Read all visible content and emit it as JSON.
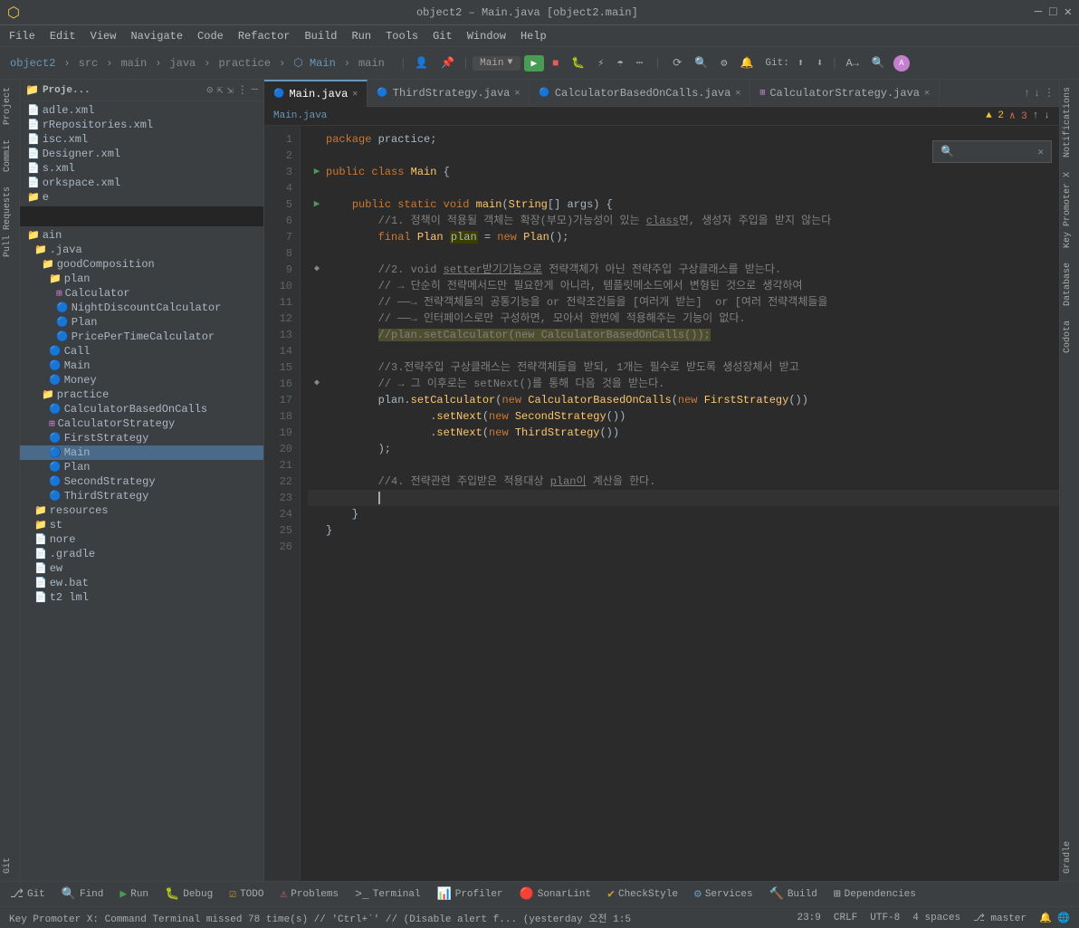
{
  "titleBar": {
    "icon": "⬡",
    "title": "object2 – Main.java [object2.main]",
    "btnMin": "─",
    "btnMax": "□",
    "btnClose": "✕"
  },
  "menuBar": {
    "items": [
      "File",
      "Edit",
      "View",
      "Navigate",
      "Code",
      "Refactor",
      "Build",
      "Run",
      "Tools",
      "Git",
      "Window",
      "Help"
    ]
  },
  "toolbar": {
    "project": "object2",
    "separator": "›",
    "path": [
      "src",
      "main",
      "java",
      "practice",
      "Main",
      "main"
    ],
    "runConfig": "Main",
    "git": "Git:",
    "gitBranch": "master"
  },
  "sidebar": {
    "title": "Proje...",
    "files": [
      {
        "name": "adle.xml",
        "icon": "📄",
        "indent": 0,
        "type": "xml"
      },
      {
        "name": "rRepositories.xml",
        "icon": "📄",
        "indent": 0,
        "type": "xml"
      },
      {
        "name": "isc.xml",
        "icon": "📄",
        "indent": 0,
        "type": "xml"
      },
      {
        "name": "Designer.xml",
        "icon": "📄",
        "indent": 0,
        "type": "xml"
      },
      {
        "name": "s.xml",
        "icon": "📄",
        "indent": 0,
        "type": "xml"
      },
      {
        "name": "orkspace.xml",
        "icon": "📄",
        "indent": 0,
        "type": "xml"
      },
      {
        "name": "e",
        "icon": "📁",
        "indent": 0,
        "type": "folder"
      },
      {
        "name": "ain",
        "icon": "📁",
        "indent": 0,
        "type": "folder"
      },
      {
        "name": ".java",
        "icon": "📁",
        "indent": 1,
        "type": "folder"
      },
      {
        "name": "goodComposition",
        "icon": "📁",
        "indent": 2,
        "type": "folder"
      },
      {
        "name": "plan",
        "icon": "📁",
        "indent": 3,
        "type": "folder"
      },
      {
        "name": "Calculator",
        "icon": "⊞",
        "indent": 4,
        "type": "class"
      },
      {
        "name": "NightDiscountCalculator",
        "icon": "🔵",
        "indent": 4,
        "type": "java"
      },
      {
        "name": "Plan",
        "icon": "🔵",
        "indent": 4,
        "type": "java"
      },
      {
        "name": "PricePerTimeCalculator",
        "icon": "🔵",
        "indent": 4,
        "type": "java"
      },
      {
        "name": "Call",
        "icon": "🔵",
        "indent": 3,
        "type": "java"
      },
      {
        "name": "Main",
        "icon": "🔵",
        "indent": 3,
        "type": "java"
      },
      {
        "name": "Money",
        "icon": "🔵",
        "indent": 3,
        "type": "java"
      },
      {
        "name": "practice",
        "icon": "📁",
        "indent": 2,
        "type": "folder"
      },
      {
        "name": "CalculatorBasedOnCalls",
        "icon": "🔵",
        "indent": 3,
        "type": "java"
      },
      {
        "name": "CalculatorStrategy",
        "icon": "⊞",
        "indent": 3,
        "type": "class"
      },
      {
        "name": "FirstStrategy",
        "icon": "🔵",
        "indent": 3,
        "type": "java"
      },
      {
        "name": "Main",
        "icon": "🔵",
        "indent": 3,
        "type": "java",
        "selected": true
      },
      {
        "name": "Plan",
        "icon": "🔵",
        "indent": 3,
        "type": "java"
      },
      {
        "name": "SecondStrategy",
        "icon": "🔵",
        "indent": 3,
        "type": "java"
      },
      {
        "name": "ThirdStrategy",
        "icon": "🔵",
        "indent": 3,
        "type": "java"
      },
      {
        "name": "resources",
        "icon": "📁",
        "indent": 1,
        "type": "folder"
      },
      {
        "name": "st",
        "icon": "📁",
        "indent": 1,
        "type": "folder"
      },
      {
        "name": "nore",
        "icon": "📄",
        "indent": 1,
        "type": "file"
      },
      {
        "name": ".gradle",
        "icon": "📄",
        "indent": 1,
        "type": "file"
      },
      {
        "name": "ew",
        "icon": "📄",
        "indent": 1,
        "type": "file"
      },
      {
        "name": "ew.bat",
        "icon": "📄",
        "indent": 1,
        "type": "file"
      },
      {
        "name": "t2 lml",
        "icon": "📄",
        "indent": 1,
        "type": "file"
      }
    ]
  },
  "tabs": [
    {
      "name": "Main.java",
      "active": true,
      "icon": "🔵"
    },
    {
      "name": "ThirdStrategy.java",
      "active": false,
      "icon": "🔵"
    },
    {
      "name": "CalculatorBasedOnCalls.java",
      "active": false,
      "icon": "🔵"
    },
    {
      "name": "CalculatorStrategy.java",
      "active": false,
      "icon": "⊞"
    }
  ],
  "editorBreadcrumb": {
    "path": "Main.java",
    "warning": "▲ 2",
    "error": "∧ 3",
    "up": "↑",
    "down": "↓"
  },
  "rightPanels": [
    "Notifications",
    "Key Promoter X",
    "Database",
    "Codota",
    "Gradle"
  ],
  "leftPanels": [
    "Project",
    "Commit",
    "Pull Requests",
    "Git"
  ],
  "code": {
    "lines": [
      {
        "num": 1,
        "gutter": "",
        "content": "<span class='kw'>package</span> practice;"
      },
      {
        "num": 2,
        "gutter": "",
        "content": ""
      },
      {
        "num": 3,
        "gutter": "▶",
        "content": "<span class='kw'>public class</span> <span class='cls'>Main</span> {"
      },
      {
        "num": 4,
        "gutter": "",
        "content": ""
      },
      {
        "num": 5,
        "gutter": "▶",
        "content": "    <span class='kw'>public static void</span> <span class='method'>main</span>(<span class='cls'>String</span>[] args) {"
      },
      {
        "num": 6,
        "gutter": "",
        "content": "        <span class='comment'>//1. 정책이 적용될 객체는 확장(부모)가능성이 있는 <span class='underline'>class</span>면, 생성자 주입을 받지 않는다</span>"
      },
      {
        "num": 7,
        "gutter": "",
        "content": "        <span class='kw'>final</span> <span class='cls'>Plan</span> <span class='highlight'>plan</span> = <span class='kw'>new</span> <span class='cls'>Plan</span>();"
      },
      {
        "num": 8,
        "gutter": "",
        "content": ""
      },
      {
        "num": 9,
        "gutter": "",
        "content": "        <span class='comment'>//2. void <span class='underline'>setter받기기능으로</span> 전략객체가 아닌 전략주입 구상클래스를 받는다.</span>"
      },
      {
        "num": 10,
        "gutter": "",
        "content": "        <span class='comment'>// → 단순히 전략메서드만 필요한게 아니라, 템플릿메소드에서 변형된 것으로 생각하여</span>"
      },
      {
        "num": 11,
        "gutter": "",
        "content": "        <span class='comment'>// ──→ 전략객체들의 공통기능을 or 전략조건들을 [여러개 받는]  or [여러 전략객체들을</span>"
      },
      {
        "num": 12,
        "gutter": "",
        "content": "        <span class='comment'>// ──→ 인터페이스로만 구성하면, 모아서 한번에 적용해주는 기능이 없다.</span>"
      },
      {
        "num": 13,
        "gutter": "",
        "content": "        <span class='comment highlight'>//plan.setCalculator(new CalculatorBasedOnCalls());</span>"
      },
      {
        "num": 14,
        "gutter": "",
        "content": ""
      },
      {
        "num": 15,
        "gutter": "",
        "content": "        <span class='comment'>//3.전략주입 구상클래스는 전략객체들을 받되, 1개는 필수로 받도록 생성장체서 받고</span>"
      },
      {
        "num": 16,
        "gutter": "",
        "content": "        <span class='comment'>// → 그 이후로는 setNext()를 통해 다음 것을 받는다.</span>"
      },
      {
        "num": 17,
        "gutter": "",
        "content": "        plan.<span class='method'>setCalculator</span>(<span class='kw'>new</span> <span class='cls'>CalculatorBasedOnCalls</span>(<span class='kw'>new</span> <span class='cls'>FirstStrategy</span>())"
      },
      {
        "num": 18,
        "gutter": "",
        "content": "                .<span class='method'>setNext</span>(<span class='kw'>new</span> <span class='cls'>SecondStrategy</span>())"
      },
      {
        "num": 19,
        "gutter": "",
        "content": "                .<span class='method'>setNext</span>(<span class='kw'>new</span> <span class='cls'>ThirdStrategy</span>())"
      },
      {
        "num": 20,
        "gutter": "",
        "content": "        );"
      },
      {
        "num": 21,
        "gutter": "",
        "content": ""
      },
      {
        "num": 22,
        "gutter": "",
        "content": "        <span class='comment'>//4. 전략관련 주입받은 적용대상 <span class='underline'>plan이</span> 계산을 한다.</span>"
      },
      {
        "num": 23,
        "gutter": "",
        "content": ""
      },
      {
        "num": 24,
        "gutter": "",
        "content": "    }"
      },
      {
        "num": 25,
        "gutter": "",
        "content": "}"
      },
      {
        "num": 26,
        "gutter": "",
        "content": ""
      }
    ]
  },
  "statusBar": {
    "keyPromoter": "Key Promoter X: Command Terminal missed 78 time(s) // 'Ctrl+`' // (Disable alert f... (yesterday 오전 1:5",
    "position": "23:9",
    "lineEnding": "CRLF",
    "encoding": "UTF-8",
    "indent": "4 spaces",
    "git": "⎇ master"
  },
  "bottomToolbar": {
    "items": [
      {
        "label": "Git",
        "icon": "⎇"
      },
      {
        "label": "Find",
        "icon": "🔍"
      },
      {
        "label": "Run",
        "icon": "▶"
      },
      {
        "label": "Debug",
        "icon": "🐛"
      },
      {
        "label": "TODO",
        "icon": "☑"
      },
      {
        "label": "Problems",
        "icon": "⚠"
      },
      {
        "label": "Terminal",
        "icon": ">"
      },
      {
        "label": "Profiler",
        "icon": "📊"
      },
      {
        "label": "SonarLint",
        "icon": "🔴"
      },
      {
        "label": "CheckStyle",
        "icon": "✔"
      },
      {
        "label": "Services",
        "icon": "⚙"
      },
      {
        "label": "Build",
        "icon": "🔨"
      },
      {
        "label": "Dependencies",
        "icon": "⊞"
      }
    ]
  }
}
